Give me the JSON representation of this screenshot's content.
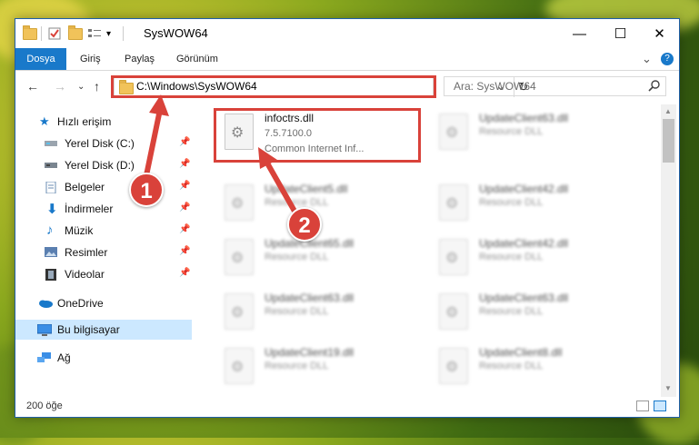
{
  "window": {
    "title": "SysWOW64",
    "minimize": "—",
    "maximize": "☐",
    "close": "✕"
  },
  "ribbon": {
    "tabs": [
      "Dosya",
      "Giriş",
      "Paylaş",
      "Görünüm"
    ],
    "expand": "⌄",
    "help": "?"
  },
  "address": {
    "path": "C:\\Windows\\SysWOW64",
    "dropdown": "⌄",
    "refresh": "↻"
  },
  "search": {
    "placeholder": "Ara: SysWOW64",
    "icon": "search-icon"
  },
  "nav": {
    "back": "←",
    "forward": "→",
    "recent": "⌄",
    "up": "↑"
  },
  "sidebar": {
    "quick_access": "Hızlı erişim",
    "items": [
      {
        "label": "Yerel Disk (C:)",
        "pinned": true
      },
      {
        "label": "Yerel Disk (D:)",
        "pinned": true
      },
      {
        "label": "Belgeler",
        "pinned": true
      },
      {
        "label": "İndirmeler",
        "pinned": true
      },
      {
        "label": "Müzik",
        "pinned": true
      },
      {
        "label": "Resimler",
        "pinned": true
      },
      {
        "label": "Videolar",
        "pinned": true
      }
    ],
    "onedrive": "OneDrive",
    "this_pc": "Bu bilgisayar",
    "network": "Ağ"
  },
  "files": [
    {
      "name": "infoctrs.dll",
      "meta1": "7.5.7100.0",
      "meta2": "Common Internet Inf...",
      "highlighted": true
    },
    {
      "name": "UpdateClient63.dll",
      "meta1": "Resource DLL"
    },
    {
      "name": "UpdateClient5.dll",
      "meta1": "Resource DLL"
    },
    {
      "name": "UpdateClient42.dll",
      "meta1": "Resource DLL"
    },
    {
      "name": "UpdateClient65.dll",
      "meta1": "Resource DLL"
    },
    {
      "name": "UpdateClient42.dll",
      "meta1": "Resource DLL"
    },
    {
      "name": "UpdateClient63.dll",
      "meta1": "Resource DLL"
    },
    {
      "name": "UpdateClient63.dll",
      "meta1": "Resource DLL"
    },
    {
      "name": "UpdateClient19.dll",
      "meta1": "Resource DLL"
    },
    {
      "name": "UpdateClient8.dll",
      "meta1": "Resource DLL"
    }
  ],
  "status": {
    "count": "200 öğe"
  },
  "annotations": {
    "step1": "1",
    "step2": "2",
    "color": "#d9423a"
  }
}
